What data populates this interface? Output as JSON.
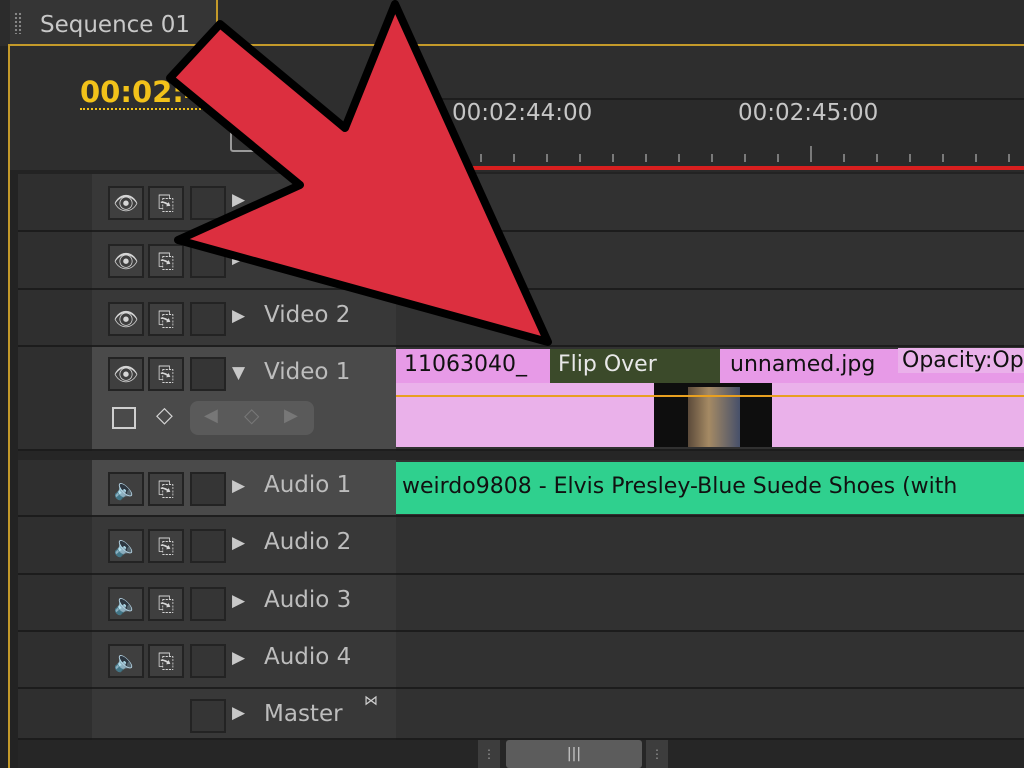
{
  "sequence_tab": {
    "title": "Sequence 01"
  },
  "timecode": "00:02:4",
  "ruler": {
    "labels": [
      "00:02:44:00",
      "00:02:45:00"
    ]
  },
  "tracks": {
    "video": [
      {
        "name": ""
      },
      {
        "name": ""
      },
      {
        "name": "Video 2"
      },
      {
        "name": "Video 1"
      }
    ],
    "audio": [
      {
        "name": "Audio 1"
      },
      {
        "name": "Audio 2"
      },
      {
        "name": "Audio 3"
      },
      {
        "name": "Audio 4"
      }
    ],
    "master": {
      "name": "Master"
    }
  },
  "clips": {
    "video1_a": "11063040_",
    "transition": "Flip Over",
    "video1_b": "unnamed.jpg",
    "opacity": "Opacity:Op",
    "audio1": "weirdo9808 - Elvis Presley-Blue Suede Shoes (with"
  },
  "icons": {
    "eye": "eye-icon",
    "sync": "sync-lock-icon",
    "speaker": "speaker-icon",
    "expand": "triangle-right-icon",
    "collapse": "triangle-down-icon",
    "annotation": "red-arrow-pointer"
  },
  "colors": {
    "accent": "#c49a2a",
    "timecode": "#f2c21a",
    "playhead": "#d81f1f",
    "video_clip": "#eab1ea",
    "audio_clip": "#2fd08e",
    "arrow": "#dc2f3f"
  }
}
